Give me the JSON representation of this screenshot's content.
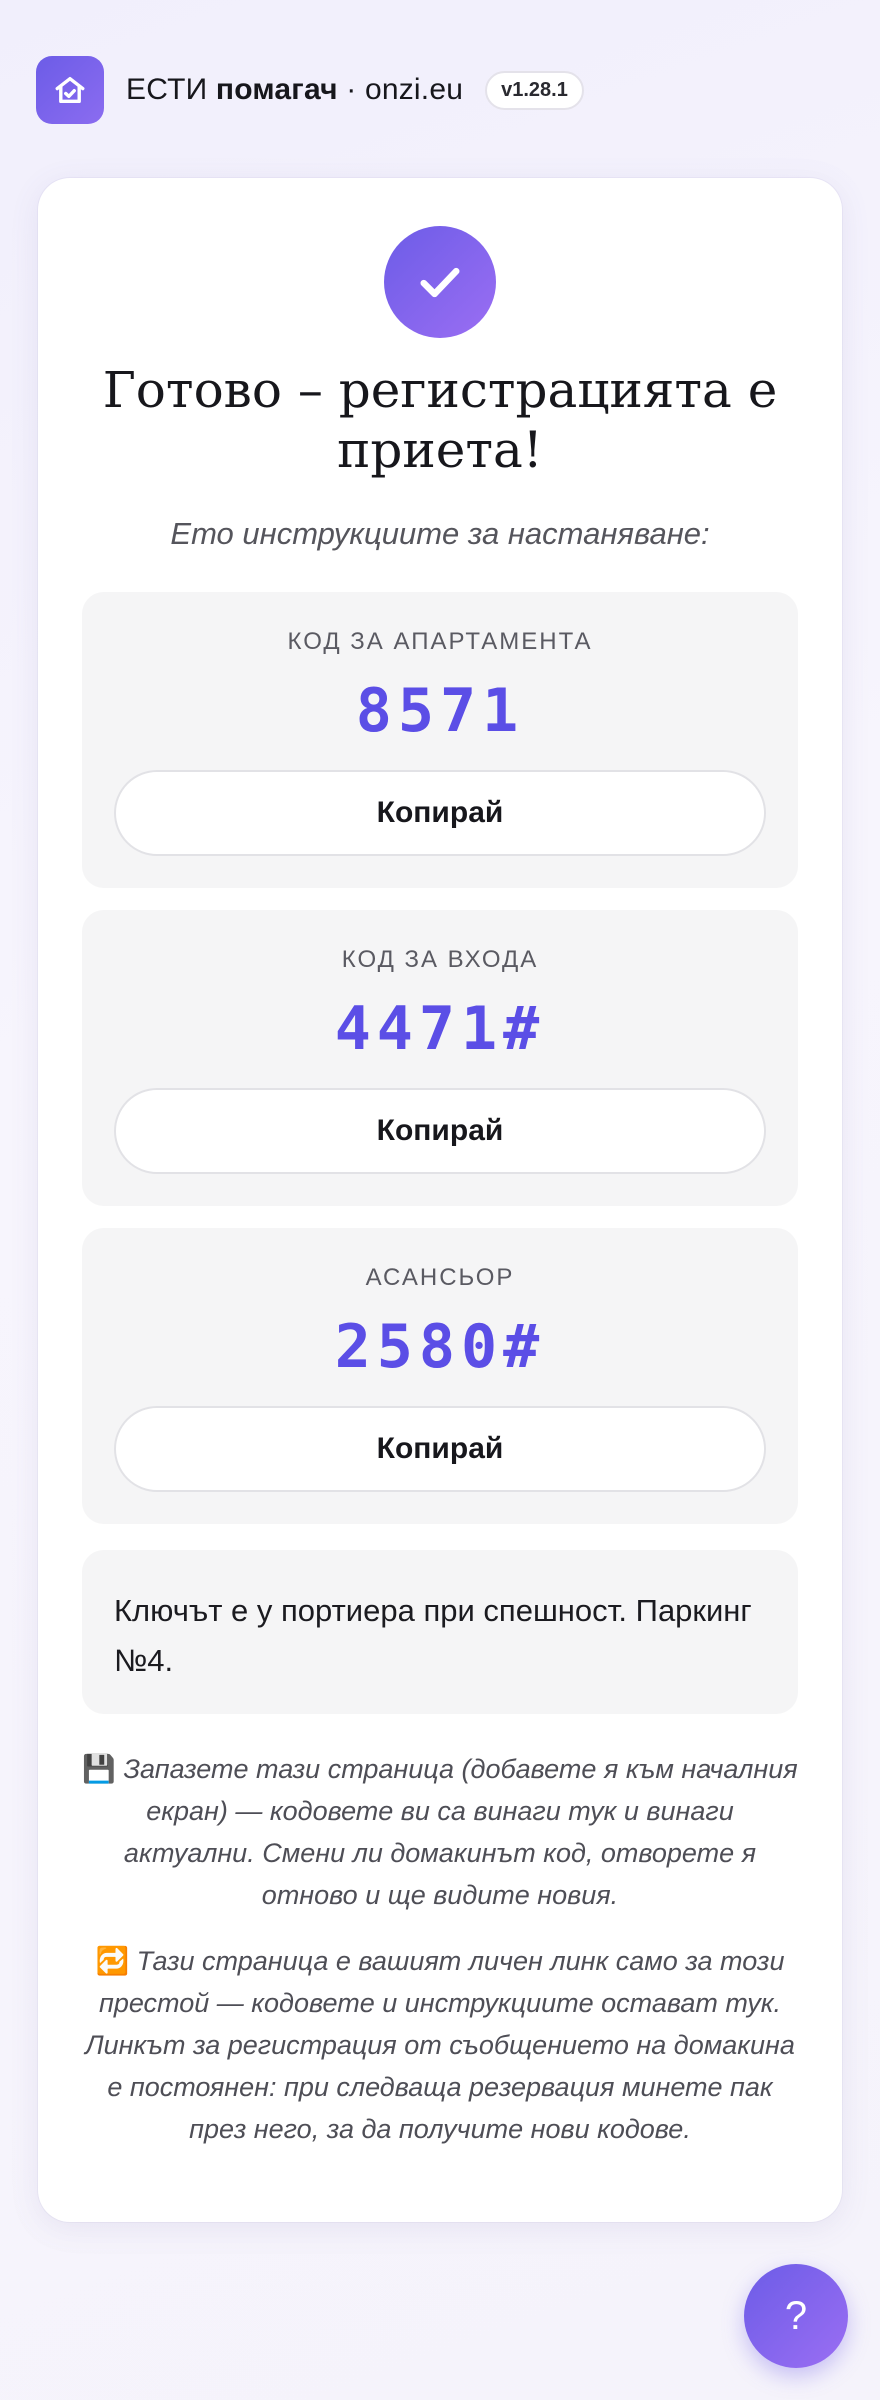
{
  "header": {
    "brand_prefix": "ЕСТИ",
    "brand_bold": "помагач",
    "brand_suffix": " · onzi.eu",
    "version": "v1.28.1"
  },
  "card": {
    "title": "Готово – регистрацията е приета!",
    "subtitle": "Ето инструкциите за настаняване:",
    "codes": [
      {
        "label": "КОД ЗА АПАРТАМЕНТА",
        "value": "8571",
        "copy_label": "Копирай"
      },
      {
        "label": "КОД ЗА ВХОДА",
        "value": "4471#",
        "copy_label": "Копирай"
      },
      {
        "label": "АСАНСЬОР",
        "value": "2580#",
        "copy_label": "Копирай"
      }
    ],
    "note": "Ключът е у портиера при спешност. Паркинг №4.",
    "save_info_emoji": "💾",
    "save_info": "Запазете тази страница (добавете я към началния екран) — кодовете ви са винаги тук и винаги актуални. Смени ли домакинът код, отворете я отново и ще видите новия.",
    "link_info_emoji": "🔁",
    "link_info": "Тази страница е вашият личен линк само за този престой — кодовете и инструкциите остават тук. Линкът за регистрация от съобщението на домакина е постоянен: при следваща резервация минете пак през него, за да получите нови кодове."
  },
  "help_button": {
    "label": "?"
  },
  "colors": {
    "accent": "#5b4ee6",
    "accent_light": "#9b6ef3"
  },
  "icons": {
    "logo": "house-icon",
    "success": "checkmark-icon"
  }
}
